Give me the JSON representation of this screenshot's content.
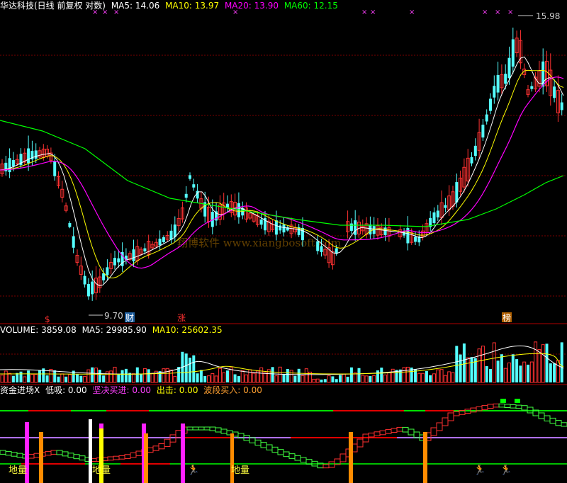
{
  "colors": {
    "up": "#ff3232",
    "down": "#54ffff",
    "ma5": "#ffffff",
    "ma10": "#ffff00",
    "ma20": "#ff00ff",
    "ma60": "#00ff00",
    "grid": "#7a0000",
    "purple": "#b070ff"
  },
  "header": {
    "title": "华达科技(日线 前复权 对数)",
    "ma5": "MA5: 14.06",
    "ma10": "MA10: 13.97",
    "ma20": "MA20: 13.90",
    "ma60": "MA60: 12.15"
  },
  "volume_header": {
    "vol": "VOLUME: 3859.08",
    "ma5": "MA5: 29985.90",
    "ma10": "MA10: 25602.35"
  },
  "indicator_header": {
    "name": "资金进场X",
    "low": "低吸: 0.00",
    "firm": "坚决买进: 0.00",
    "strike": "出击: 0.00",
    "wave": "波段买入: 0.00"
  },
  "annotations": {
    "high": "15.98",
    "low": "9.70",
    "cai1": "财",
    "zhang": "涨",
    "bang": "榜",
    "dili": "地量",
    "sym1": "$",
    "watermark": "翔博软件 www.xiangbosoft.com"
  },
  "chart_data": [
    {
      "type": "candlestick",
      "title": "华达科技(日线 前复权 对数)",
      "y_marks": {
        "high": 15.98,
        "low": 9.7
      },
      "series": [
        {
          "name": "MA5",
          "value": 14.06
        },
        {
          "name": "MA10",
          "value": 13.97
        },
        {
          "name": "MA20",
          "value": 13.9
        },
        {
          "name": "MA60",
          "value": 12.15
        }
      ]
    },
    {
      "type": "bar",
      "title": "VOLUME",
      "series": [
        {
          "name": "VOLUME",
          "value": 3859.08
        },
        {
          "name": "MA5",
          "value": 29985.9
        },
        {
          "name": "MA10",
          "value": 25602.35
        }
      ]
    },
    {
      "type": "line",
      "title": "资金进场X",
      "series": [
        {
          "name": "低吸",
          "value": 0.0
        },
        {
          "name": "坚决买进",
          "value": 0.0
        },
        {
          "name": "出击",
          "value": 0.0
        },
        {
          "name": "波段买入",
          "value": 0.0
        }
      ]
    }
  ]
}
